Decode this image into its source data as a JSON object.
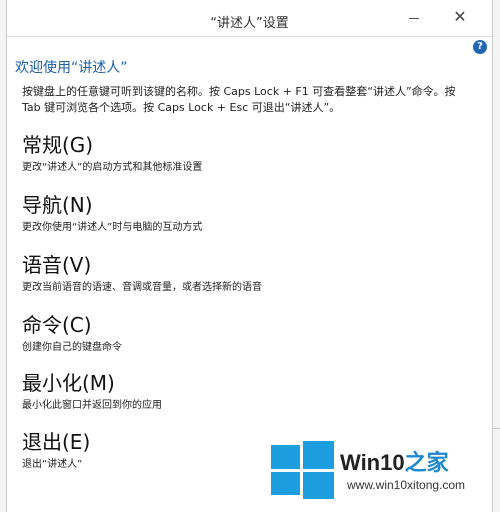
{
  "window": {
    "title": "“讲述人”设置",
    "minimize_glyph": "—",
    "close_glyph": "✕",
    "help_glyph": "?"
  },
  "welcome": "欢迎使用“讲述人”",
  "intro": "按键盘上的任意键可听到该键的名称。按 Caps Lock + F1 可查看整套“讲述人”命令。按 Tab 键可浏览各个选项。按 Caps Lock + Esc 可退出“讲述人”。",
  "sections": [
    {
      "heading": "常规(G)",
      "desc": "更改“讲述人”的启动方式和其他标准设置"
    },
    {
      "heading": "导航(N)",
      "desc": "更改你使用“讲述人”时与电脑的互动方式"
    },
    {
      "heading": "语音(V)",
      "desc": "更改当前语音的语速、音调或音量，或者选择新的语音"
    },
    {
      "heading": "命令(C)",
      "desc": "创建你自己的键盘命令"
    },
    {
      "heading": "最小化(M)",
      "desc": "最小化此窗口并返回到你的应用"
    },
    {
      "heading": "退出(E)",
      "desc": "退出“讲述人”"
    }
  ],
  "watermark": {
    "title_part1": "Win10",
    "title_part2": "之家",
    "url": "www.win10xitong.com"
  },
  "colors": {
    "accent": "#1f5fa8",
    "help": "#1f66b5",
    "logo": "#1c9ee0"
  }
}
